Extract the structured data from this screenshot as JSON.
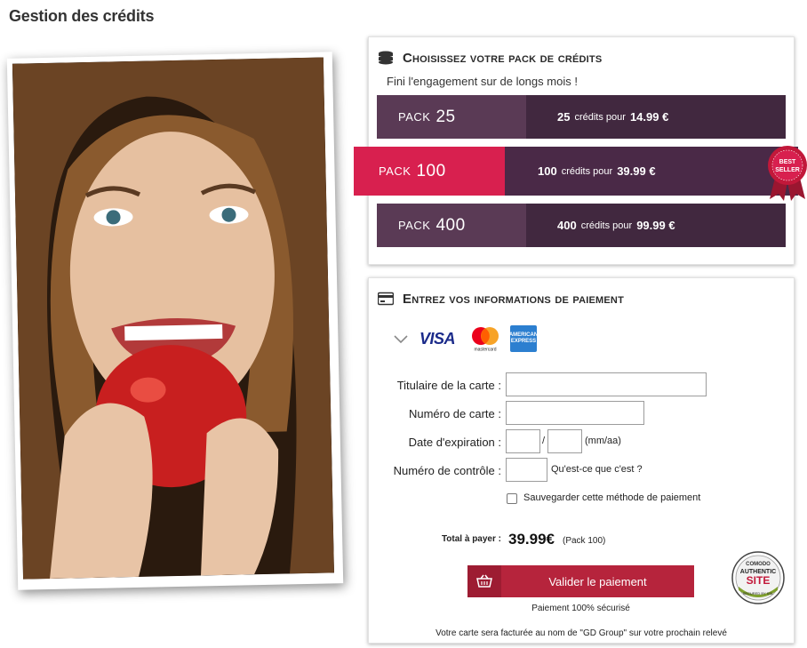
{
  "page": {
    "title": "Gestion des crédits"
  },
  "packs_panel": {
    "heading": "Choisissez votre pack de crédits",
    "subtitle": "Fini l'engagement sur de longs mois !",
    "packs": [
      {
        "prefix": "PACK",
        "number": "25",
        "credits": "25",
        "credits_text": "crédits pour",
        "price": "14.99 €",
        "selected": false
      },
      {
        "prefix": "PACK",
        "number": "100",
        "credits": "100",
        "credits_text": "crédits pour",
        "price": "39.99 €",
        "selected": true
      },
      {
        "prefix": "PACK",
        "number": "400",
        "credits": "400",
        "credits_text": "crédits pour",
        "price": "99.99 €",
        "selected": false
      }
    ],
    "badge": {
      "line1": "BEST",
      "line2": "SELLER"
    }
  },
  "payment_panel": {
    "heading": "Entrez vos informations de paiement",
    "card_brands": {
      "visa": "VISA",
      "mastercard": "mastercard",
      "amex": "AMERICAN EXPRESS"
    },
    "fields": {
      "holder_label": "Titulaire de la carte :",
      "number_label": "Numéro de carte :",
      "expiry_label": "Date d'expiration :",
      "expiry_sep": "/",
      "expiry_hint": "(mm/aa)",
      "cvc_label": "Numéro de contrôle :",
      "cvc_help": "Qu'est-ce que c'est ?"
    },
    "save_label": "Sauvegarder cette méthode de paiement",
    "total_label": "Total à payer :",
    "total_value": "39.99€",
    "total_pack": "(Pack 100)",
    "pay_button": "Valider le paiement",
    "secure_note": "Paiement 100% sécurisé",
    "billing_note": "Votre carte sera facturée au nom de \"GD Group\" sur votre prochain relevé",
    "comodo": {
      "line1": "COMODO",
      "line2": "AUTHENTIC",
      "line3": "SITE",
      "line4": "SECURED BY SSL"
    }
  },
  "colors": {
    "accent": "#d8204f",
    "pack_dark": "#41283f",
    "pack_light": "#5a3a55",
    "button": "#b6243c"
  }
}
